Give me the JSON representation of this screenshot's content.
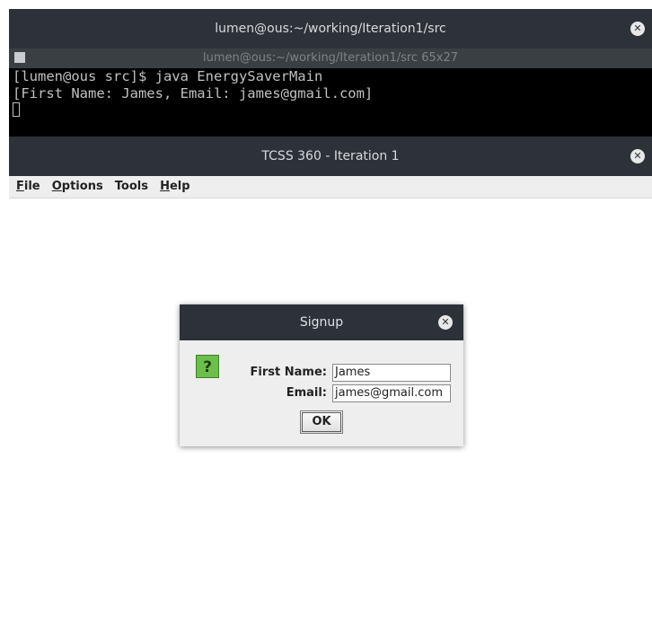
{
  "terminal": {
    "window_title": "lumen@ous:~/working/Iteration1/src",
    "subtitle": "lumen@ous:~/working/Iteration1/src 65x27",
    "lines": [
      "[lumen@ous src]$ java EnergySaverMain",
      "[First Name: James, Email: james@gmail.com]"
    ]
  },
  "app": {
    "window_title": "TCSS 360 - Iteration 1",
    "menu": [
      "File",
      "Options",
      "Tools",
      "Help"
    ]
  },
  "dialog": {
    "title": "Signup",
    "icon": "question-icon",
    "icon_glyph": "?",
    "first_name_label": "First Name:",
    "first_name_value": "James",
    "email_label": "Email:",
    "email_value": "james@gmail.com",
    "ok_label": "OK"
  },
  "icons": {
    "close": "⊗"
  },
  "colors": {
    "titlebar": "#2d3238",
    "terminal_bg": "#000000",
    "question_icon": "#6cbf4a"
  }
}
